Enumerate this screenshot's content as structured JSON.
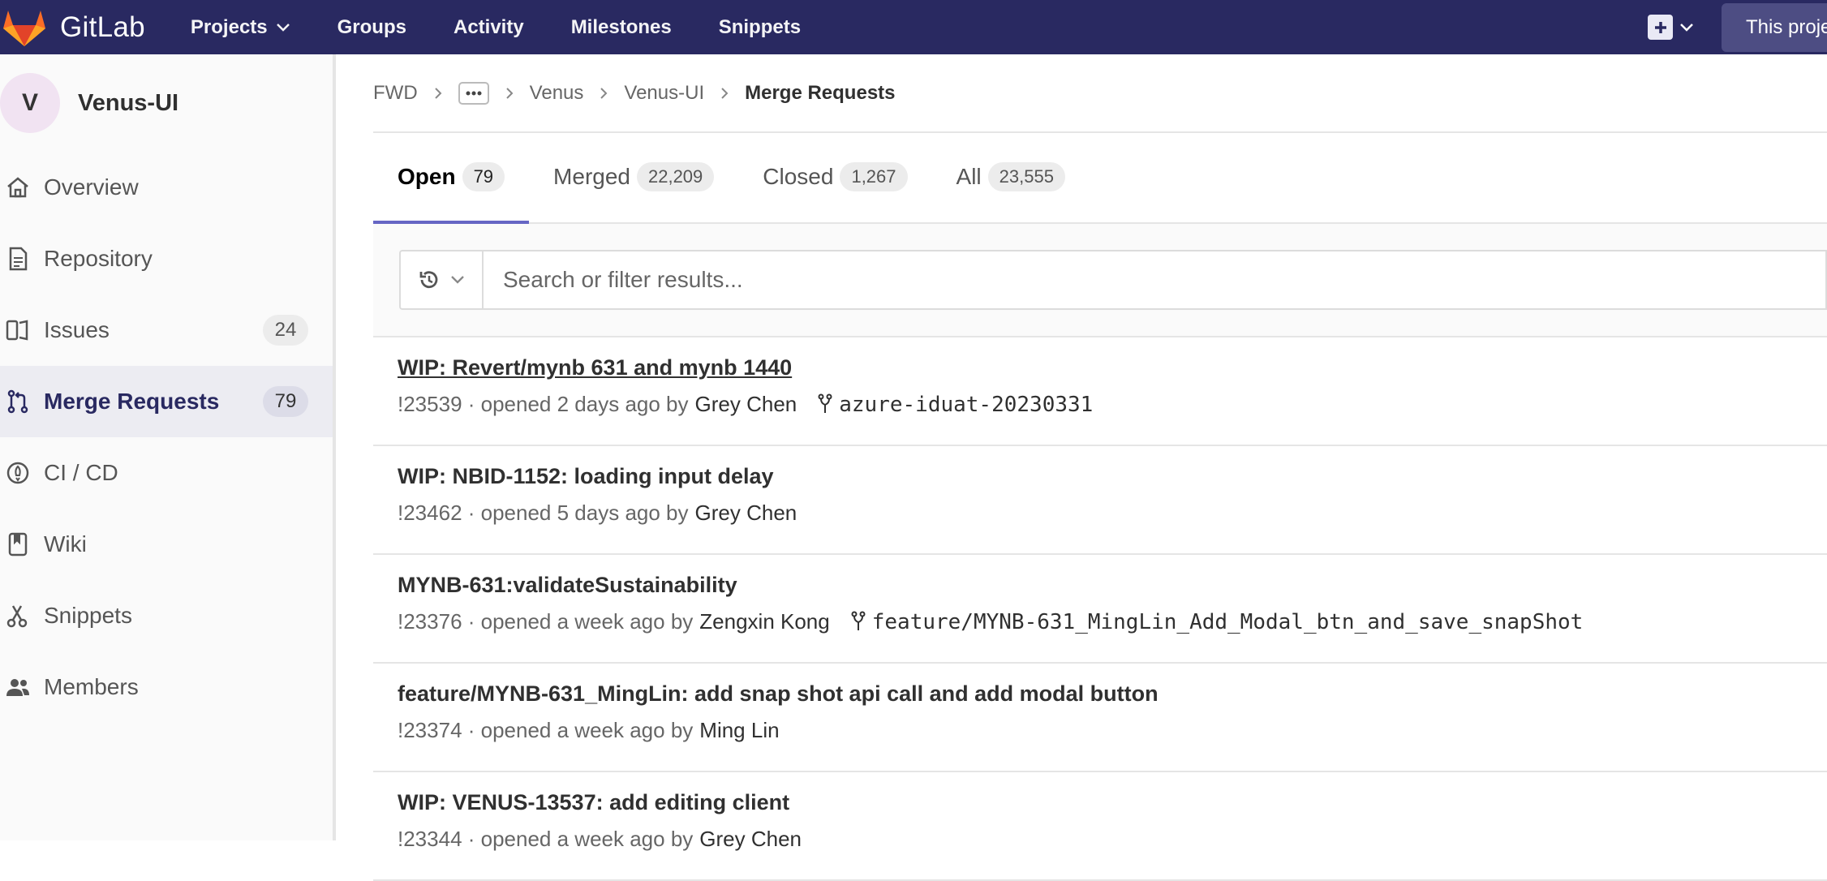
{
  "brand": {
    "name": "GitLab"
  },
  "nav": {
    "links": [
      {
        "label": "Projects",
        "has_dropdown": true
      },
      {
        "label": "Groups"
      },
      {
        "label": "Activity"
      },
      {
        "label": "Milestones"
      },
      {
        "label": "Snippets"
      }
    ],
    "search_placeholder": "This proje"
  },
  "sidebar": {
    "project_initial": "V",
    "project_name": "Venus-UI",
    "items": [
      {
        "label": "Overview",
        "icon": "home-icon"
      },
      {
        "label": "Repository",
        "icon": "doc-icon"
      },
      {
        "label": "Issues",
        "icon": "issues-icon",
        "count": "24"
      },
      {
        "label": "Merge Requests",
        "icon": "merge-request-icon",
        "count": "79",
        "active": true
      },
      {
        "label": "CI / CD",
        "icon": "rocket-icon"
      },
      {
        "label": "Wiki",
        "icon": "book-icon"
      },
      {
        "label": "Snippets",
        "icon": "scissors-icon"
      },
      {
        "label": "Members",
        "icon": "users-icon"
      }
    ]
  },
  "breadcrumb": {
    "items": [
      "FWD",
      "Venus",
      "Venus-UI"
    ],
    "current": "Merge Requests"
  },
  "tabs": [
    {
      "label": "Open",
      "count": "79",
      "active": true
    },
    {
      "label": "Merged",
      "count": "22,209"
    },
    {
      "label": "Closed",
      "count": "1,267"
    },
    {
      "label": "All",
      "count": "23,555"
    }
  ],
  "filter": {
    "placeholder": "Search or filter results..."
  },
  "merge_requests": [
    {
      "title": "WIP: Revert/mynb 631 and mynb 1440",
      "meta": "!23539 · opened 2 days ago by",
      "author": "Grey Chen",
      "branch": "azure-iduat-20230331"
    },
    {
      "title": "WIP: NBID-1152: loading input delay",
      "meta": "!23462 · opened 5 days ago by",
      "author": "Grey Chen"
    },
    {
      "title": "MYNB-631:validateSustainability",
      "meta": "!23376 · opened a week ago by",
      "author": "Zengxin Kong",
      "branch": "feature/MYNB-631_MingLin_Add_Modal_btn_and_save_snapShot"
    },
    {
      "title": "feature/MYNB-631_MingLin: add snap shot api call and add modal button",
      "meta": "!23374 · opened a week ago by",
      "author": "Ming Lin"
    },
    {
      "title": "WIP: VENUS-13537: add editing client",
      "meta": "!23344 · opened a week ago by",
      "author": "Grey Chen"
    }
  ],
  "colors": {
    "navbar": "#292961",
    "accent": "#6666c4"
  }
}
